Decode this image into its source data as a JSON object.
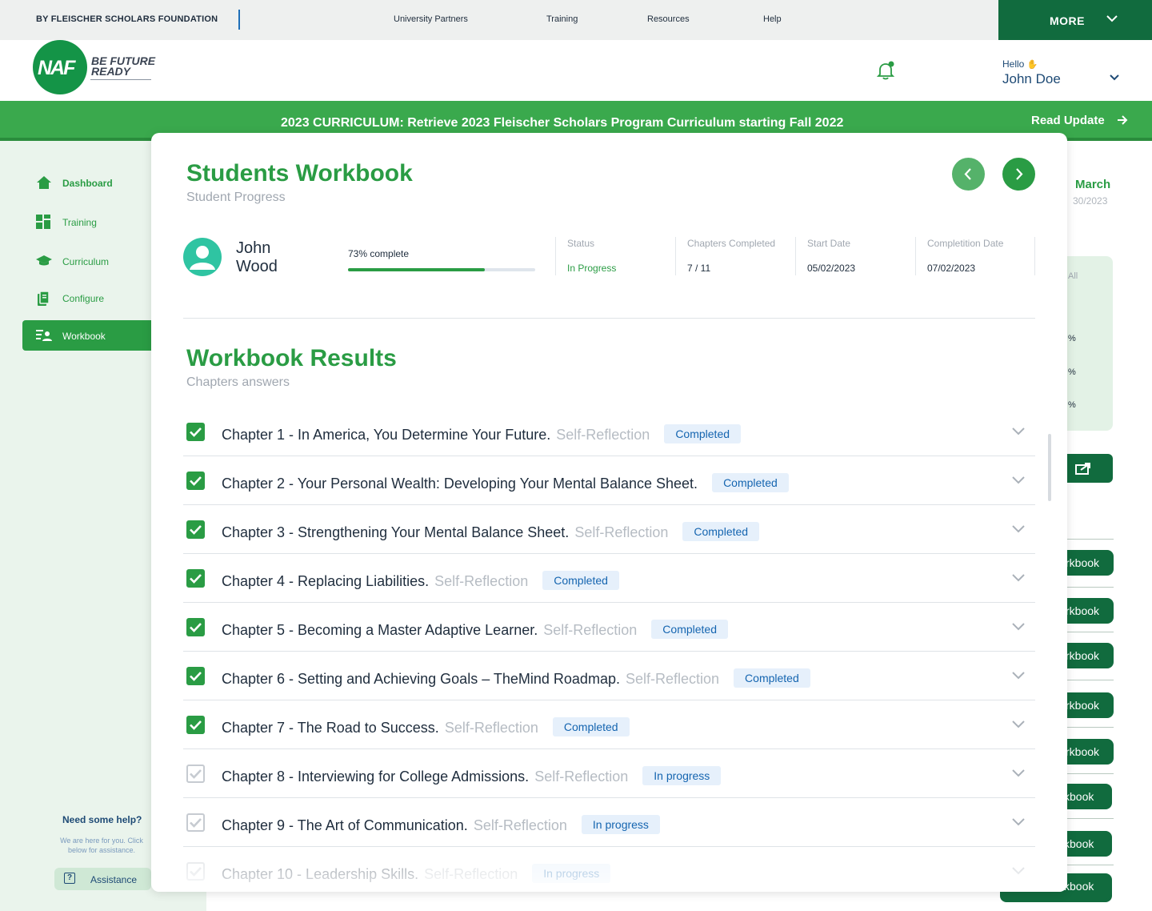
{
  "topbar": {
    "org": "BY FLEISCHER SCHOLARS FOUNDATION",
    "nav": [
      "University Partners",
      "Training",
      "Resources",
      "Help"
    ],
    "more": "MORE"
  },
  "header": {
    "logo_text": "NAF",
    "tagline_1": "BE FUTURE",
    "tagline_2": "READY",
    "hello": "Hello",
    "user": "John Doe"
  },
  "banner": {
    "message": "2023 CURRICULUM: Retrieve 2023 Fleischer Scholars Program Curriculum starting Fall 2022",
    "action": "Read Update"
  },
  "sidebar": {
    "items": [
      {
        "label": "Dashboard",
        "icon": "home-icon"
      },
      {
        "label": "Training",
        "icon": "grid-icon"
      },
      {
        "label": "Curriculum",
        "icon": "graduation-cap-icon"
      },
      {
        "label": "Configure",
        "icon": "documents-icon"
      },
      {
        "label": "Workbook",
        "icon": "user-list-icon"
      }
    ],
    "help_title": "Need some help?",
    "help_text": "We are here for you. Click below for assistance.",
    "assist_label": "Assistance"
  },
  "background": {
    "month": "March",
    "date": "30/2023",
    "card_label": "All",
    "pct": [
      "%",
      "%",
      "%"
    ],
    "buttons": [
      "rkbook",
      "rkbook",
      "rkbook",
      "rkbook",
      "rkbook",
      "kbook",
      "kbook",
      "kbook"
    ]
  },
  "modal": {
    "title": "Students Workbook",
    "subtitle": "Student Progress",
    "student_first": "John",
    "student_last": "Wood",
    "progress_label": "73% complete",
    "progress": 0.73,
    "stats": [
      {
        "label": "Status",
        "value": "In Progress"
      },
      {
        "label": "Chapters Completed",
        "value": "7 / 11"
      },
      {
        "label": "Start Date",
        "value": "05/02/2023"
      },
      {
        "label": "Completition Date",
        "value": "07/02/2023"
      }
    ],
    "results_title": "Workbook Results",
    "results_subtitle": "Chapters answers",
    "chapters": [
      {
        "title": "Chapter 1 - In America, You Determine Your Future.",
        "tag": "Self-Reflection",
        "status": "Completed",
        "checked": true
      },
      {
        "title": "Chapter 2 - Your Personal Wealth: Developing Your Mental Balance Sheet.",
        "tag": "",
        "status": "Completed",
        "checked": true
      },
      {
        "title": "Chapter 3 - Strengthening Your Mental Balance Sheet.",
        "tag": "Self-Reflection",
        "status": "Completed",
        "checked": true
      },
      {
        "title": "Chapter 4 - Replacing Liabilities.",
        "tag": "Self-Reflection",
        "status": "Completed",
        "checked": true
      },
      {
        "title": "Chapter 5 - Becoming a Master Adaptive Learner.",
        "tag": "Self-Reflection",
        "status": "Completed",
        "checked": true
      },
      {
        "title": "Chapter 6 - Setting and Achieving Goals – TheMind Roadmap.",
        "tag": "Self-Reflection",
        "status": "Completed",
        "checked": true
      },
      {
        "title": "Chapter 7 - The Road to Success.",
        "tag": "Self-Reflection",
        "status": "Completed",
        "checked": true
      },
      {
        "title": "Chapter 8 - Interviewing for College Admissions.",
        "tag": "Self-Reflection",
        "status": "In progress",
        "checked": false
      },
      {
        "title": "Chapter 9 - The Art of Communication.",
        "tag": "Self-Reflection",
        "status": "In progress",
        "checked": false
      },
      {
        "title": "Chapter 10 - Leadership Skills.",
        "tag": "Self-Reflection",
        "status": "In progress",
        "checked": false
      }
    ]
  },
  "colors": {
    "brand_green": "#2a9c44",
    "dark_green": "#116b3e",
    "banner_green": "#3aa94d",
    "badge_blue": "#1565b0"
  }
}
